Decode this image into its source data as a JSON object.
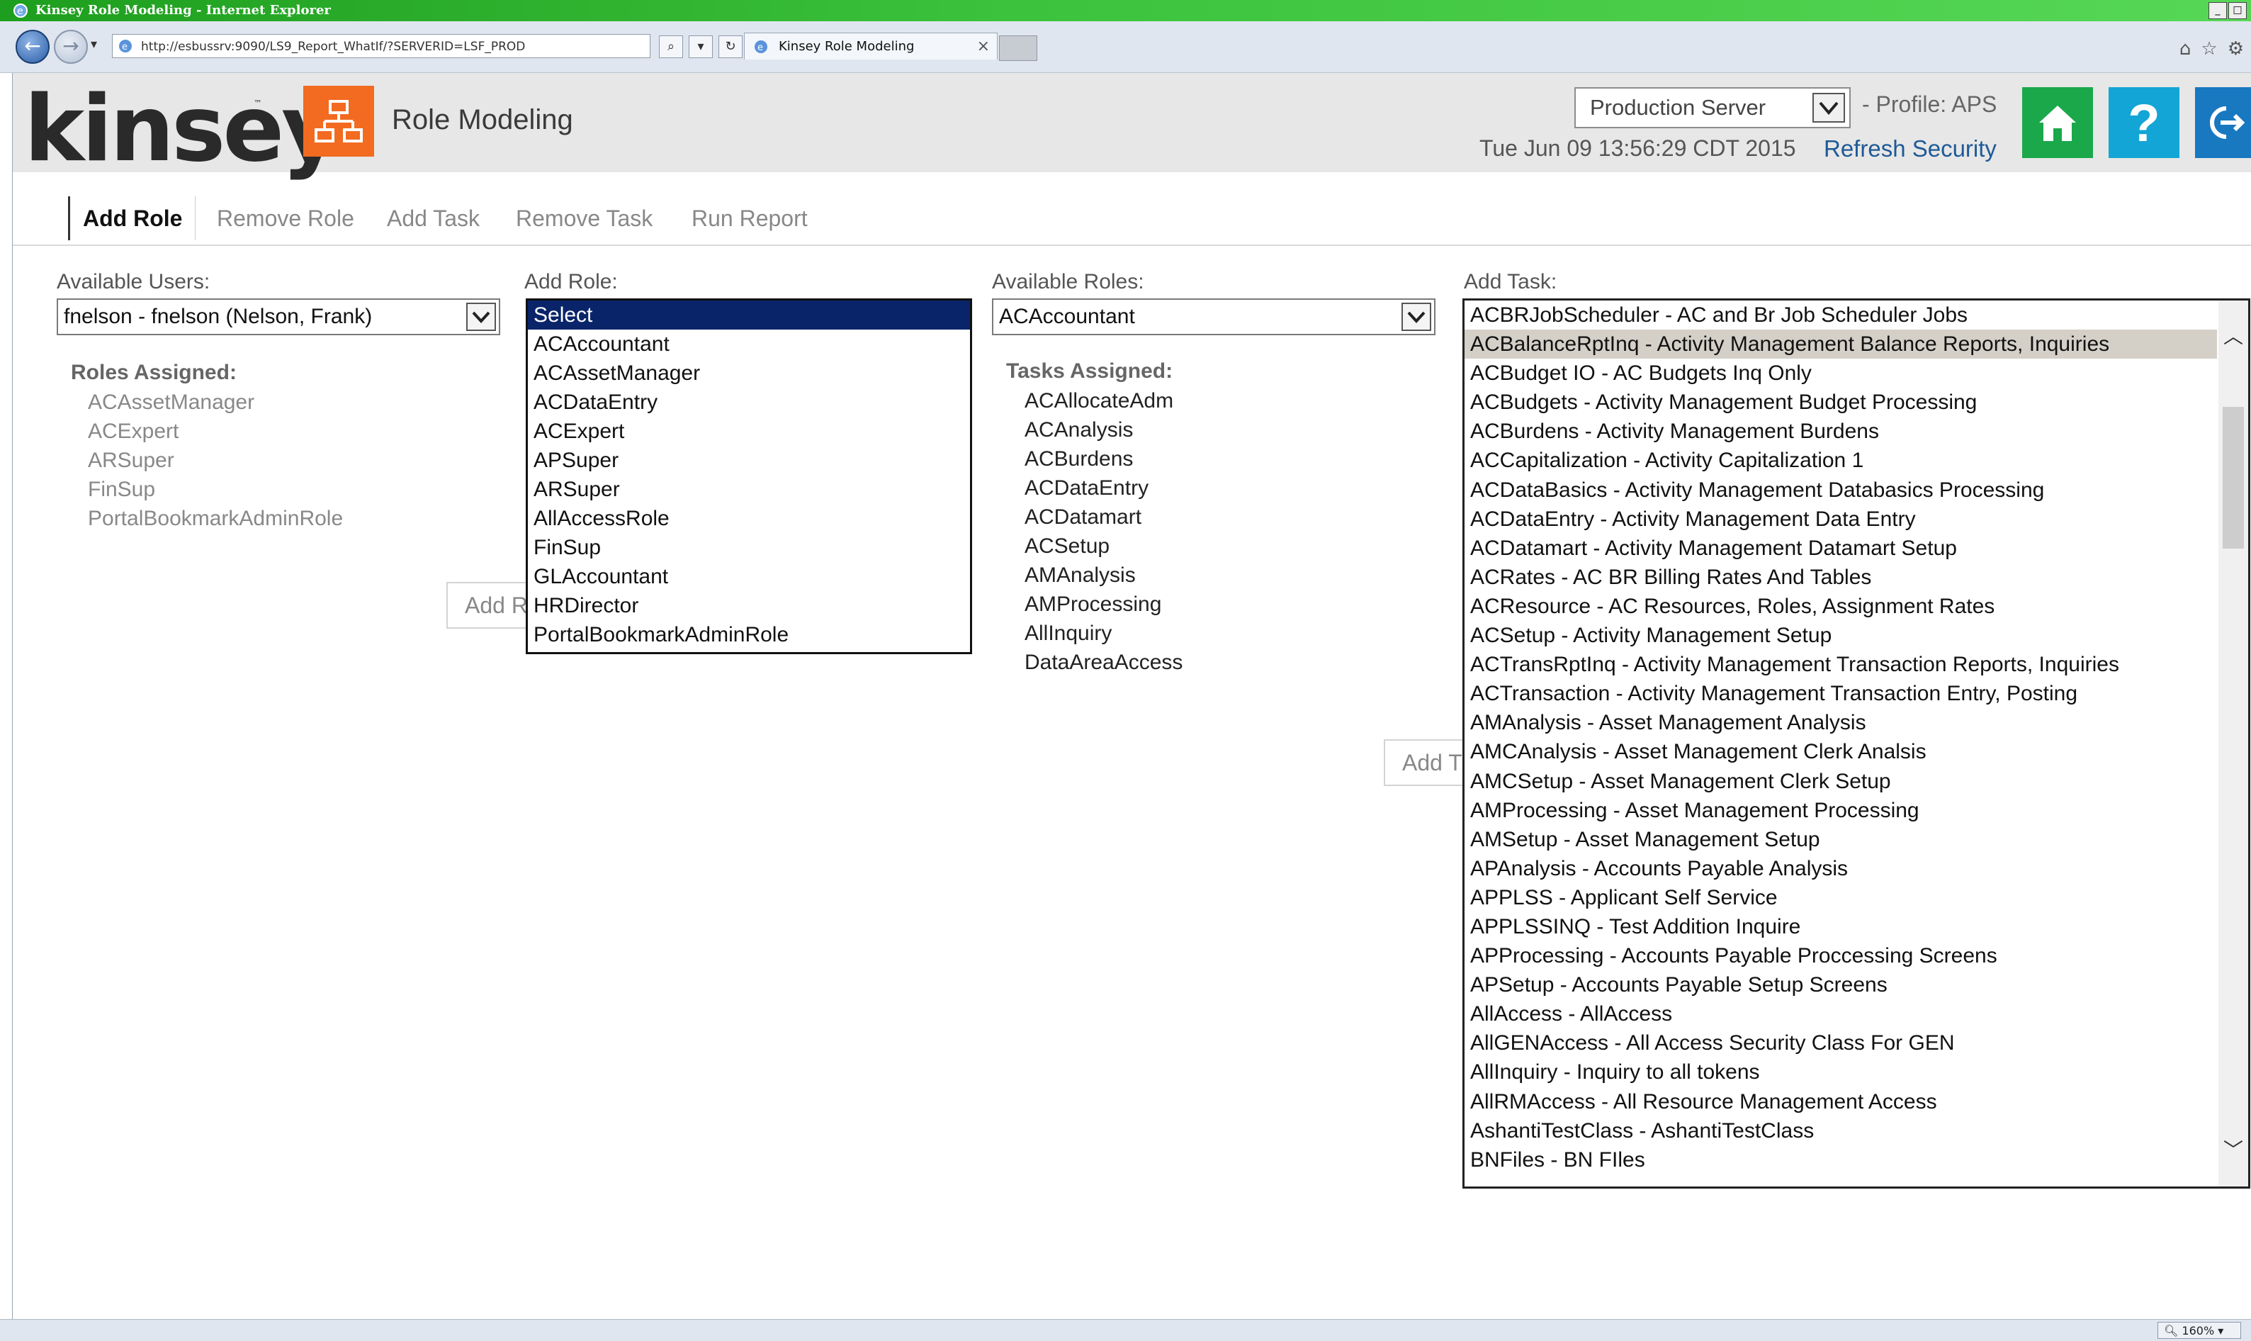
{
  "browser": {
    "window_title": "Kinsey Role Modeling - Internet Explorer",
    "address": "http://esbussrv:9090/LS9_Report_WhatIf/?SERVERID=LSF_PROD",
    "tab_title": "Kinsey Role Modeling",
    "tab_close": "×",
    "zoom": "160%"
  },
  "header": {
    "logo": "kinsey",
    "logo_tm": "™",
    "module_title": "Role Modeling",
    "server_select": "Production Server",
    "profile": "- Profile: APS",
    "datetime": "Tue Jun 09 13:56:29 CDT 2015",
    "refresh": "Refresh Security",
    "help_label": "?",
    "colors": {
      "module_icon": "#f26b21",
      "home": "#1aa84a",
      "help": "#13a5d6",
      "logout": "#1878c0"
    }
  },
  "nav": {
    "tabs": [
      "Add Role",
      "Remove Role",
      "Add Task",
      "Remove Task",
      "Run Report"
    ],
    "active": "Add Role"
  },
  "users_panel": {
    "label": "Available Users:",
    "selected": "fnelson - fnelson (Nelson, Frank)",
    "roles_assigned_label": "Roles Assigned:",
    "roles_assigned": [
      "ACAssetManager",
      "ACExpert",
      "ARSuper",
      "FinSup",
      "PortalBookmarkAdminRole"
    ]
  },
  "add_role_panel": {
    "label": "Add Role:",
    "options": [
      "Select",
      "ACAccountant",
      "ACAssetManager",
      "ACDataEntry",
      "ACExpert",
      "APSuper",
      "ARSuper",
      "AllAccessRole",
      "FinSup",
      "GLAccountant",
      "HRDirector",
      "PortalBookmarkAdminRole"
    ],
    "selected": "Select",
    "button_label": "Add R"
  },
  "roles_panel": {
    "label": "Available Roles:",
    "selected": "ACAccountant",
    "tasks_assigned_label": "Tasks Assigned:",
    "tasks_assigned": [
      "ACAllocateAdm",
      "ACAnalysis",
      "ACBurdens",
      "ACDataEntry",
      "ACDatamart",
      "ACSetup",
      "AMAnalysis",
      "AMProcessing",
      "AllInquiry",
      "DataAreaAccess"
    ]
  },
  "add_task_panel": {
    "label": "Add Task:",
    "button_label": "Add T",
    "highlighted": "ACBalanceRptInq - Activity Management Balance Reports, Inquiries",
    "options": [
      "ACBRJobScheduler - AC and Br Job Scheduler Jobs",
      "ACBalanceRptInq - Activity Management Balance Reports, Inquiries",
      "ACBudget IO - AC Budgets Inq Only",
      "ACBudgets - Activity Management Budget Processing",
      "ACBurdens - Activity Management Burdens",
      "ACCapitalization - Activity Capitalization 1",
      "ACDataBasics - Activity Management Databasics Processing",
      "ACDataEntry - Activity Management Data Entry",
      "ACDatamart - Activity Management Datamart Setup",
      "ACRates - AC BR Billing Rates And Tables",
      "ACResource - AC Resources, Roles, Assignment Rates",
      "ACSetup - Activity Management Setup",
      "ACTransRptInq - Activity Management Transaction Reports, Inquiries",
      "ACTransaction - Activity Management Transaction Entry, Posting",
      "AMAnalysis - Asset Management Analysis",
      "AMCAnalysis - Asset Management Clerk Analsis",
      "AMCSetup - Asset Management Clerk Setup",
      "AMProcessing - Asset Management Processing",
      "AMSetup - Asset Management Setup",
      "APAnalysis - Accounts Payable Analysis",
      "APPLSS - Applicant Self Service",
      "APPLSSINQ - Test Addition Inquire",
      "APProcessing - Accounts Payable Proccessing Screens",
      "APSetup - Accounts Payable Setup Screens",
      "AllAccess - AllAccess",
      "AllGENAccess - All Access Security Class For GEN",
      "AllInquiry - Inquiry to all tokens",
      "AllRMAccess - All Resource Management Access",
      "AshantiTestClass - AshantiTestClass",
      "BNFiles - BN FIles"
    ]
  }
}
